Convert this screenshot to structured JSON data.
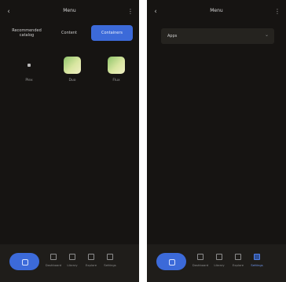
{
  "left_screen": {
    "title": "Menu",
    "filters": [
      "Recommended catalog",
      "Content",
      "Containers"
    ],
    "apps": [
      {
        "label": "Plex",
        "icon": "app-generic-icon"
      },
      {
        "label": "Duo",
        "icon": "app-green-icon"
      },
      {
        "label": "Flux",
        "icon": "app-green-icon"
      }
    ],
    "nav": [
      "Dashboard",
      "Library",
      "Explore",
      "Settings"
    ]
  },
  "right_screen": {
    "title": "Menu",
    "dropdown": {
      "value": "Apps"
    },
    "nav": [
      "Dashboard",
      "Library",
      "Explore",
      "Settings"
    ]
  },
  "colors": {
    "background": "#161412",
    "accent": "#3c6ad9",
    "bar": "#1f1d1a"
  }
}
